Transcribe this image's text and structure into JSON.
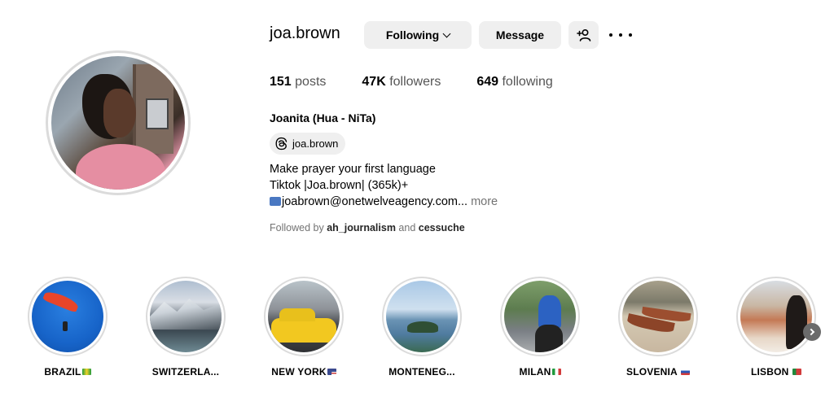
{
  "profile": {
    "username": "joa.brown",
    "full_name": "Joanita (Hua - NiTa)",
    "threads_handle": "joa.brown",
    "bio": {
      "line1": "Make prayer your first language",
      "line2": "Tiktok |Joa.brown| (365k)+",
      "line3": "joabrown@onetwelveagency.com...",
      "more": " more"
    },
    "followed_by": {
      "prefix": "Followed by ",
      "user1": "ah_journalism",
      "joiner": " and ",
      "user2": "cessuche"
    }
  },
  "actions": {
    "following_label": "Following",
    "message_label": "Message"
  },
  "stats": {
    "posts": {
      "value": "151",
      "label": " posts"
    },
    "followers": {
      "value": "47K",
      "label": " followers"
    },
    "following": {
      "value": "649",
      "label": " following"
    }
  },
  "highlights": [
    {
      "label": "BRAZIL",
      "flag": "br"
    },
    {
      "label": "SWITZERLA...",
      "flag": ""
    },
    {
      "label": "NEW YORK",
      "flag": "us"
    },
    {
      "label": "MONTENEG...",
      "flag": ""
    },
    {
      "label": "MILAN",
      "flag": "it"
    },
    {
      "label": "SLOVENIA ",
      "flag": "si"
    },
    {
      "label": "LISBON ",
      "flag": "pt"
    }
  ],
  "icons": {
    "follow_chevron": "chevron-down-icon",
    "suggest": "add-person-icon",
    "more": "more-horizontal-icon",
    "threads": "threads-icon",
    "mail": "inbox-tray-icon",
    "next": "chevron-right-icon"
  },
  "colors": {
    "button_bg": "#efefef",
    "ring": "#dbdbdb",
    "muted_text": "#737373"
  }
}
